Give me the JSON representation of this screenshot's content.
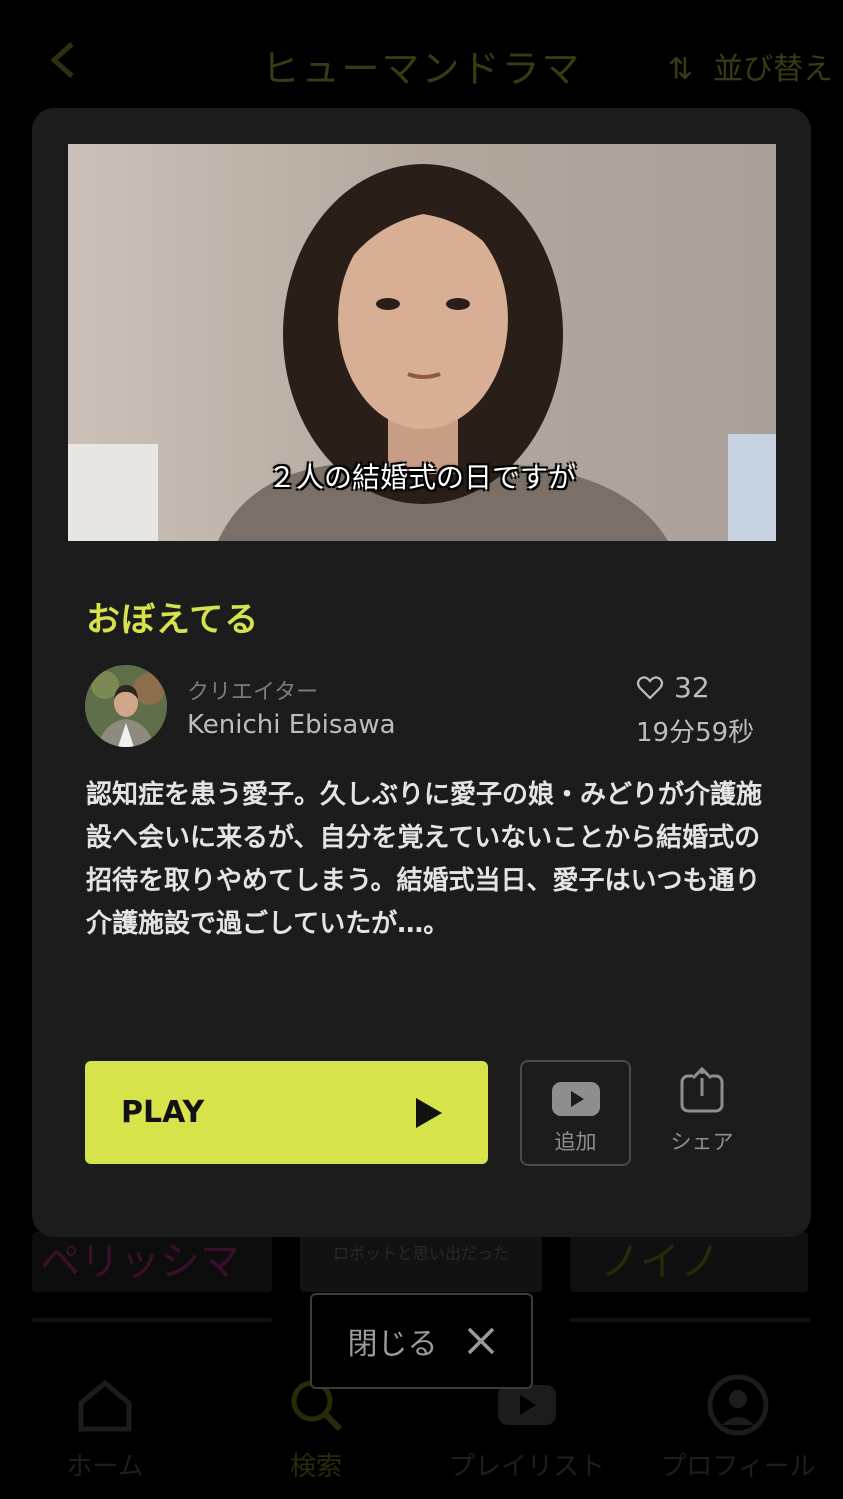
{
  "background": {
    "header": {
      "title": "ヒューマンドラマ",
      "sort_label": "並び替え"
    },
    "cards": {
      "card1_text": "ペリッシマ",
      "card2_text": "ロボットと思い出だった",
      "card3_text": "ノイノ"
    },
    "bottom_nav": {
      "items": [
        {
          "label": "ホーム",
          "icon": "home-icon"
        },
        {
          "label": "検索",
          "icon": "search-icon"
        },
        {
          "label": "プレイリスト",
          "icon": "playlist-icon"
        },
        {
          "label": "プロフィール",
          "icon": "profile-icon"
        }
      ]
    }
  },
  "modal": {
    "subtitle": "２人の結婚式の日ですが",
    "title": "おぼえてる",
    "creator": {
      "role": "クリエイター",
      "name": "Kenichi Ebisawa"
    },
    "likes": "32",
    "duration": "19分59秒",
    "description": "認知症を患う愛子。久しぶりに愛子の娘・みどりが介護施設へ会いに来るが、自分を覚えていないことから結婚式の招待を取りやめてしまう。結婚式当日、愛子はいつも通り介護施設で過ごしていたが…。",
    "buttons": {
      "play": "PLAY",
      "add": "追加",
      "share": "シェア"
    }
  },
  "close_button": {
    "label": "閉じる"
  },
  "colors": {
    "accent": "#d6e34a",
    "modal_bg": "#1c1c1c",
    "page_bg": "#000000"
  }
}
